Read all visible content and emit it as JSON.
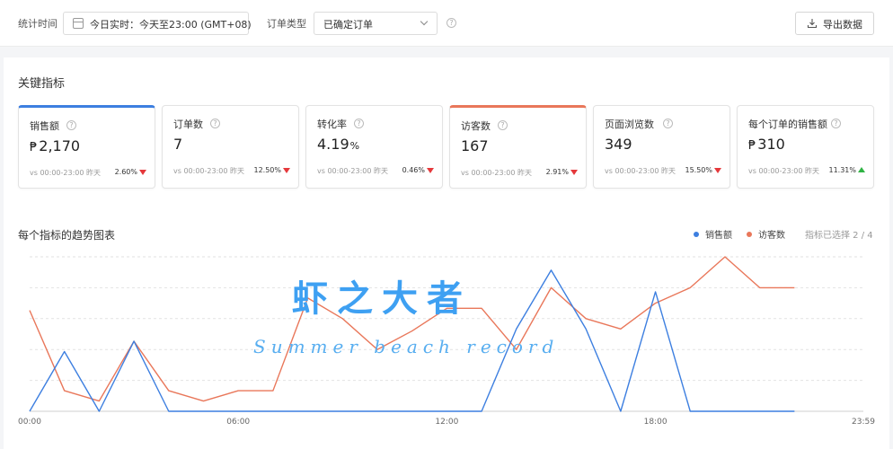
{
  "filter_bar": {
    "period_label": "统计时间",
    "date_value": "今日实时：今天至23:00 (GMT+08)",
    "order_type_label": "订单类型",
    "order_type_value": "已确定订单",
    "help_glyph": "?",
    "export_label": "导出数据"
  },
  "section": {
    "title": "关键指标"
  },
  "metrics": [
    {
      "name": "销售额",
      "prefix": "₱",
      "value": "2,170",
      "suffix": "",
      "vs": "vs 00:00-23:00 昨天",
      "change": "2.60%",
      "direction": "down"
    },
    {
      "name": "订单数",
      "prefix": "",
      "value": "7",
      "suffix": "",
      "vs": "vs 00:00-23:00 昨天",
      "change": "12.50%",
      "direction": "down"
    },
    {
      "name": "转化率",
      "prefix": "",
      "value": "4.19",
      "suffix": "%",
      "vs": "vs 00:00-23:00 昨天",
      "change": "0.46%",
      "direction": "down"
    },
    {
      "name": "访客数",
      "prefix": "",
      "value": "167",
      "suffix": "",
      "vs": "vs 00:00-23:00 昨天",
      "change": "2.91%",
      "direction": "down"
    },
    {
      "name": "页面浏览数",
      "prefix": "",
      "value": "349",
      "suffix": "",
      "vs": "vs 00:00-23:00 昨天",
      "change": "15.50%",
      "direction": "down"
    },
    {
      "name": "每个订单的销售额",
      "prefix": "₱",
      "value": "310",
      "suffix": "",
      "vs": "vs 00:00-23:00 昨天",
      "change": "11.31%",
      "direction": "up"
    }
  ],
  "chart_section": {
    "title": "每个指标的趋势图表",
    "selected_count": "指标已选择 2 / 4"
  },
  "watermark": {
    "cn": "虾之大者",
    "en": "Summer beach record"
  },
  "colors": {
    "sales": "#3d7fe0",
    "visitors": "#e9775a",
    "up": "#2fb344",
    "down": "#e5383b"
  },
  "chart_data": {
    "type": "line",
    "x": [
      "00:00",
      "01:00",
      "02:00",
      "03:00",
      "04:00",
      "05:00",
      "06:00",
      "07:00",
      "08:00",
      "09:00",
      "10:00",
      "11:00",
      "12:00",
      "13:00",
      "14:00",
      "15:00",
      "16:00",
      "17:00",
      "18:00",
      "19:00",
      "20:00",
      "21:00",
      "22:00"
    ],
    "x_tick_labels": [
      "00:00",
      "06:00",
      "12:00",
      "18:00",
      "23:59"
    ],
    "x_tick_positions": [
      0,
      6,
      12,
      18,
      23.98
    ],
    "xlim": [
      0,
      23.98
    ],
    "ylim": [
      0,
      150
    ],
    "grid": true,
    "legend_position": "top-right",
    "series": [
      {
        "name": "销售额",
        "color": "#3d7fe0",
        "values": [
          0,
          58,
          0,
          68,
          0,
          0,
          0,
          0,
          0,
          0,
          0,
          0,
          0,
          0,
          80,
          137,
          80,
          0,
          116,
          0,
          0,
          0,
          0
        ]
      },
      {
        "name": "访客数",
        "color": "#e9775a",
        "values": [
          98,
          20,
          10,
          68,
          20,
          10,
          20,
          20,
          110,
          90,
          60,
          78,
          100,
          100,
          60,
          120,
          90,
          80,
          105,
          120,
          150,
          120,
          120
        ]
      }
    ]
  }
}
